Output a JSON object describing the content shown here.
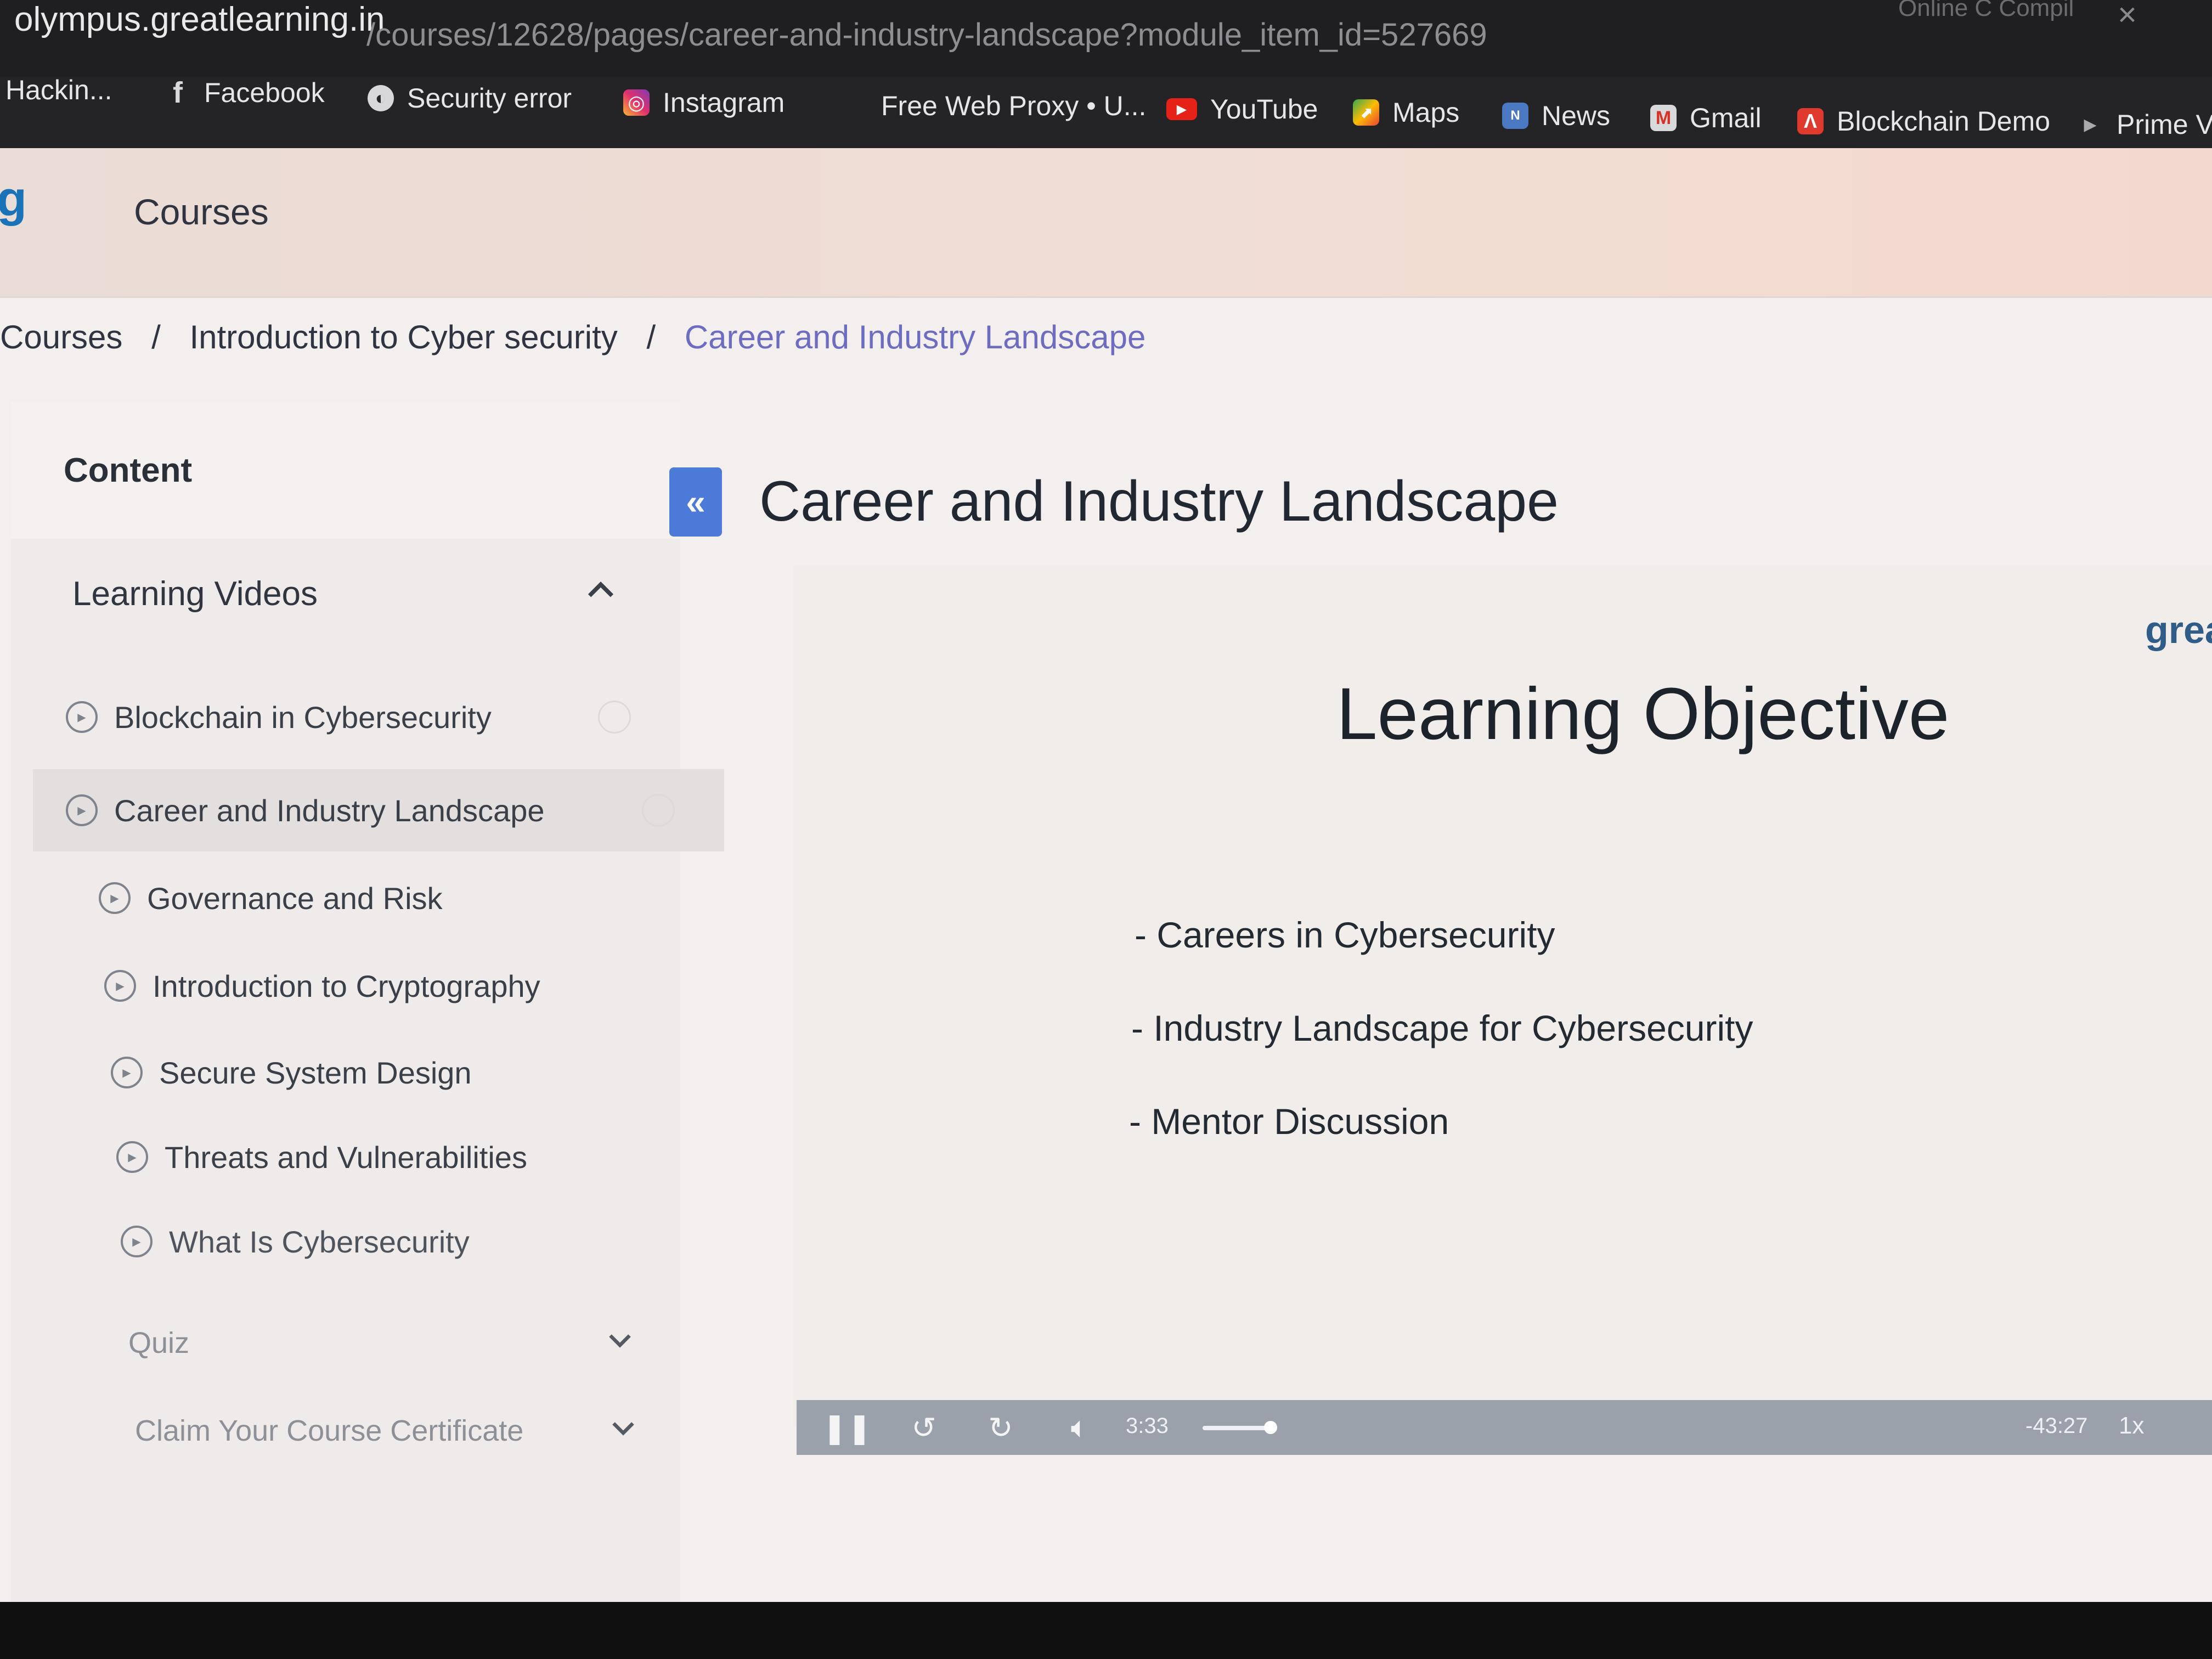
{
  "browser": {
    "url_host": "olympus.greatlearning.in",
    "url_path": "/courses/12628/pages/career-and-industry-landscape?module_item_id=527669",
    "topright_text": "Online C Compil",
    "bookmarks": [
      {
        "label": "Hackin...",
        "icon": "none"
      },
      {
        "label": "Facebook",
        "icon": "facebook-icon"
      },
      {
        "label": "Security error",
        "icon": "globe-icon"
      },
      {
        "label": "Instagram",
        "icon": "instagram-icon"
      },
      {
        "label": "Free Web Proxy • U...",
        "icon": "none"
      },
      {
        "label": "YouTube",
        "icon": "youtube-icon"
      },
      {
        "label": "Maps",
        "icon": "maps-icon"
      },
      {
        "label": "News",
        "icon": "news-icon"
      },
      {
        "label": "Gmail",
        "icon": "gmail-icon"
      },
      {
        "label": "Blockchain Demo",
        "icon": "blockchain-icon"
      },
      {
        "label": "Prime Vi",
        "icon": "prime-video-icon"
      }
    ]
  },
  "nav": {
    "logo": "g",
    "courses_label": "Courses"
  },
  "breadcrumb": {
    "items": [
      "Courses",
      "Introduction to Cyber security",
      "Career and Industry Landscape"
    ],
    "separator": "/"
  },
  "sidebar": {
    "heading": "Content",
    "section": {
      "title": "Learning Videos",
      "expanded": true,
      "lessons": [
        {
          "label": "Blockchain in Cybersecurity",
          "active": false
        },
        {
          "label": "Career and Industry Landscape",
          "active": true
        },
        {
          "label": "Governance and Risk",
          "active": false
        },
        {
          "label": "Introduction to Cryptography",
          "active": false
        },
        {
          "label": "Secure System Design",
          "active": false
        },
        {
          "label": "Threats and Vulnerabilities",
          "active": false
        },
        {
          "label": "What Is Cybersecurity",
          "active": false
        }
      ]
    },
    "collapsed_sections": [
      "Quiz",
      "Claim Your Course Certificate"
    ]
  },
  "main": {
    "title": "Career and Industry Landscape",
    "collapse_glyph": "«",
    "brand_text": "grea",
    "slide": {
      "heading": "Learning Objective",
      "points": [
        "- Careers in Cybersecurity",
        "- Industry Landscape for Cybersecurity",
        "- Mentor Discussion"
      ]
    },
    "player": {
      "current_time": "3:33",
      "remaining_time": "-43:27",
      "speed": "1x"
    }
  },
  "colors": {
    "accent_blue": "#4d79d8",
    "breadcrumb_current": "#6d6cc0",
    "controls_bar": "#9aa1ab"
  }
}
